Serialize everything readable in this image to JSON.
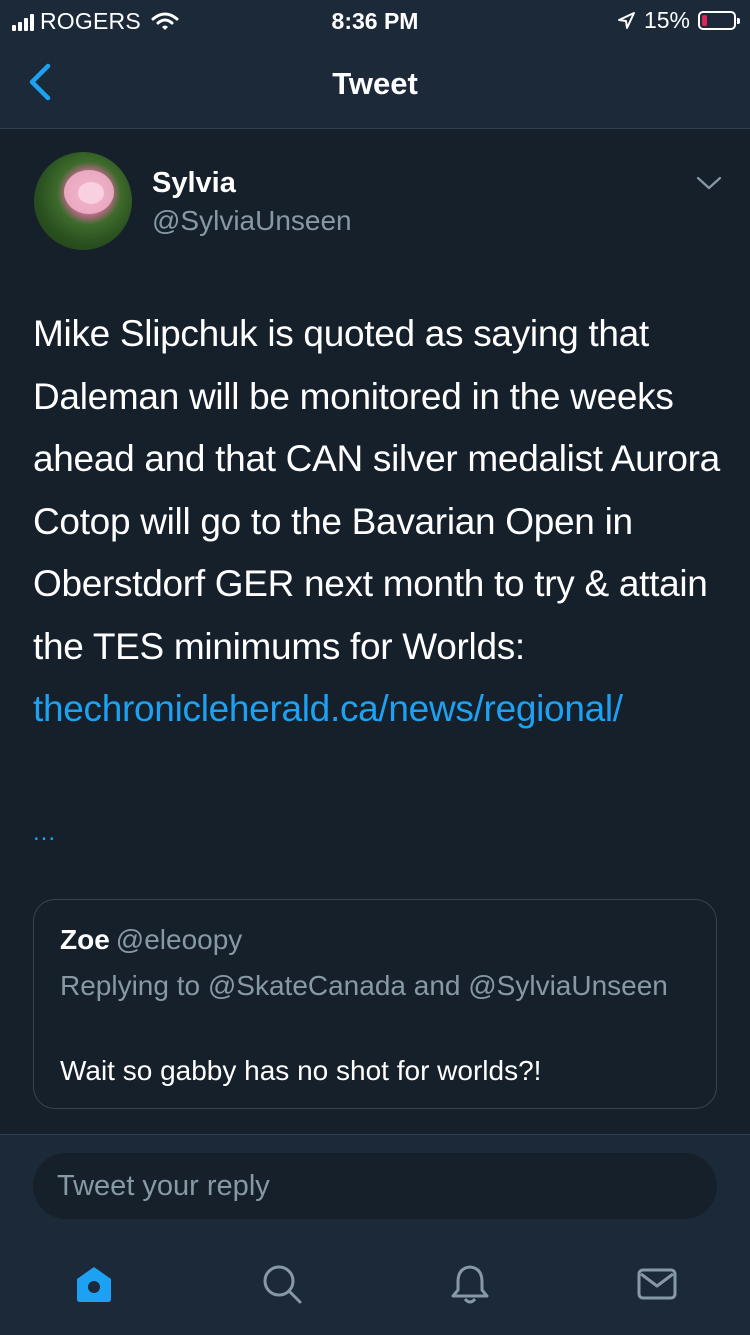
{
  "status_bar": {
    "carrier": "ROGERS",
    "time": "8:36 PM",
    "battery_text": "15%",
    "battery_level": 0.15,
    "battery_color": "#e0245e"
  },
  "nav": {
    "title": "Tweet",
    "back_icon": "chevron-left-icon"
  },
  "tweet": {
    "author_name": "Sylvia",
    "author_handle": "@SylviaUnseen",
    "text": "Mike Slipchuk is quoted as saying that Daleman will be monitored in the weeks ahead and that CAN silver medalist Aurora Cotop will go to the Bavarian Open in Oberstdorf GER next month to try & attain the TES minimums for Worlds: ",
    "link": "thechronicleherald.ca/news/regional/",
    "ellipsis": "...",
    "menu_icon": "chevron-down-icon"
  },
  "quoted_tweet": {
    "author_name": "Zoe",
    "author_handle": "@eleoopy",
    "replying_to": "Replying to @SkateCanada and @SylviaUnseen",
    "text": "Wait so gabby has no shot for worlds?!"
  },
  "reply_box": {
    "placeholder": "Tweet your reply"
  },
  "tab_bar": {
    "items": [
      {
        "name": "home",
        "icon": "home-icon",
        "active": true
      },
      {
        "name": "search",
        "icon": "search-icon",
        "active": false
      },
      {
        "name": "notifications",
        "icon": "bell-icon",
        "active": false
      },
      {
        "name": "messages",
        "icon": "envelope-icon",
        "active": false
      }
    ]
  },
  "colors": {
    "background": "#15202b",
    "bar": "#1c2938",
    "accent": "#1da1f2",
    "secondary_text": "#8899a6"
  }
}
